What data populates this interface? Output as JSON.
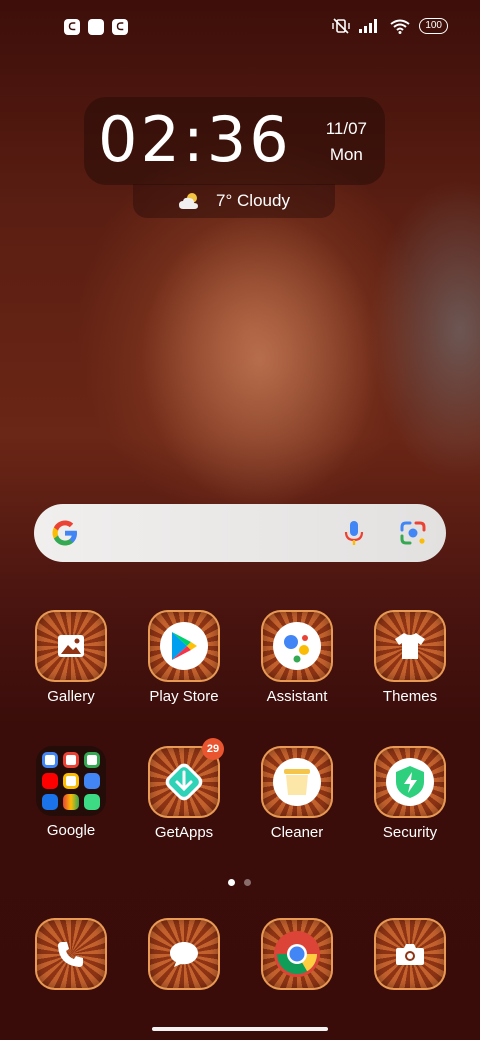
{
  "status_bar": {
    "left_icons": [
      "notification-icon",
      "square-icon",
      "notification-icon"
    ],
    "right_icons": [
      "vibrate-off-icon",
      "signal-icon",
      "wifi-icon"
    ],
    "battery": "100"
  },
  "clock_widget": {
    "time": "02:36",
    "date": "11/07",
    "day": "Mon",
    "weather_icon": "partly-cloudy-icon",
    "weather": "7° Cloudy"
  },
  "search_bar": {
    "icons": [
      "google-logo",
      "microphone-icon",
      "lens-icon"
    ]
  },
  "apps": [
    {
      "label": "Gallery",
      "icon": "gallery-icon"
    },
    {
      "label": "Play Store",
      "icon": "play-store-icon"
    },
    {
      "label": "Assistant",
      "icon": "assistant-icon"
    },
    {
      "label": "Themes",
      "icon": "themes-icon"
    },
    {
      "label": "Google",
      "icon": "folder-icon"
    },
    {
      "label": "GetApps",
      "icon": "getapps-icon",
      "badge": "29"
    },
    {
      "label": "Cleaner",
      "icon": "cleaner-icon"
    },
    {
      "label": "Security",
      "icon": "security-icon"
    }
  ],
  "page_indicator": {
    "pages": 2,
    "current": 1
  },
  "dock": [
    {
      "icon": "phone-icon"
    },
    {
      "icon": "messages-icon"
    },
    {
      "icon": "chrome-icon"
    },
    {
      "icon": "camera-icon"
    }
  ],
  "colors": {
    "accent_badge": "#e8552f",
    "wallpaper_base": "#3a0d0a"
  }
}
